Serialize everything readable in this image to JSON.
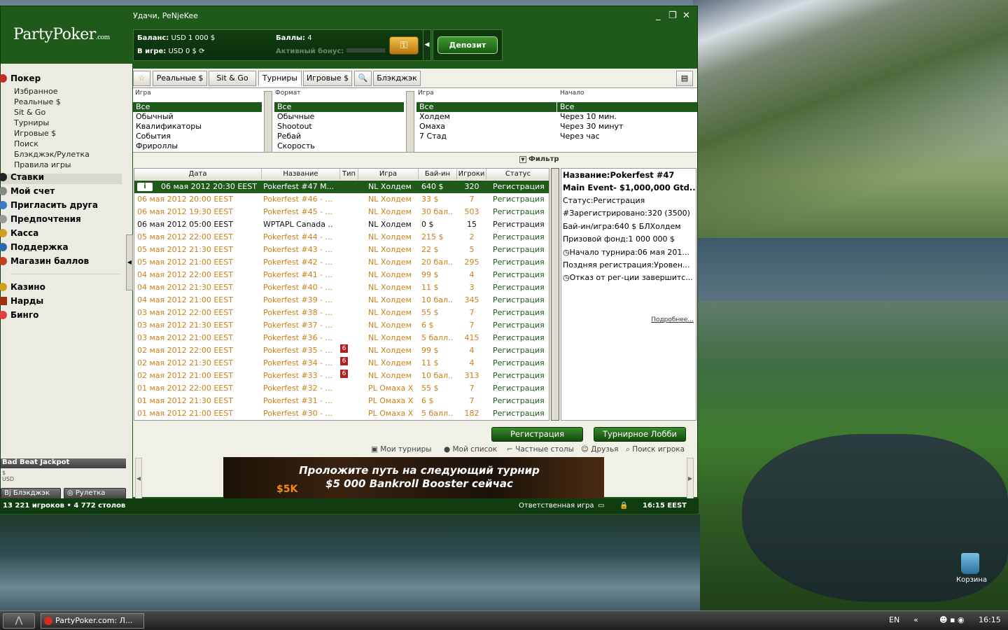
{
  "window": {
    "greeting": "Удачи, PeNjeKee",
    "logo": "PartyPoker",
    "logo_suffix": ".com",
    "controls": [
      "_",
      "❐",
      "✕"
    ]
  },
  "account": {
    "balance_label": "Баланс:",
    "balance_value": "USD 1 000 $",
    "ingame_label": "В игре:",
    "ingame_value": "USD 0 $",
    "points_label": "Баллы:",
    "points_value": "4",
    "bonus_label": "Активный бонус:",
    "deposit": "Депозит"
  },
  "sidebar": {
    "poker": "Покер",
    "poker_items": [
      "Избранное",
      "Реальные $",
      "Sit & Go",
      "Турниры",
      "Игровые $",
      "Поиск",
      "Блэкджэк/Рулетка",
      "Правила игры"
    ],
    "sections": [
      "Ставки",
      "Мой счет",
      "Пригласить друга",
      "Предпочтения",
      "Касса",
      "Поддержка",
      "Магазин баллов"
    ],
    "games": [
      "Казино",
      "Нарды",
      "Бинго"
    ],
    "jackpot": "Bad Beat Jackpot",
    "jackpot_cur": "$",
    "jackpot_usd": "USD",
    "blackjack": "Блэкджэк",
    "roulette": "Рулетка"
  },
  "tabs": [
    "Реальные $",
    "Sit & Go",
    "Турниры",
    "Игровые $",
    "Блэкджэк"
  ],
  "filters": {
    "game1_header": "Игра",
    "game1": [
      "Все",
      "Обычный",
      "Квалификаторы",
      "События",
      "Фрироллы"
    ],
    "format_header": "Формат",
    "format": [
      "Все",
      "Обычные",
      "Shootout",
      "Ребай",
      "Скорость"
    ],
    "game2_header": "Игра",
    "game2": [
      "Все",
      "Холдем",
      "Омаха",
      "7 Стад"
    ],
    "start_header": "Начало",
    "start": [
      "Все",
      "Через 10 мин.",
      "Через 30 минут",
      "Через час"
    ],
    "filter_label": "Фильтр"
  },
  "grid": {
    "headers": [
      "Дата",
      "Название",
      "Тип",
      "Игра",
      "Бай-ин",
      "Игроки",
      "Статус"
    ],
    "rows": [
      {
        "date": "06 мая 2012 20:30 EEST",
        "name": "Pokerfest #47 M...",
        "type": "",
        "game": "NL Холдем",
        "buyin": "640 $",
        "players": "320",
        "status": "Регистрация"
      },
      {
        "date": "06 мая 2012 20:00 EEST",
        "name": "Pokerfest #46 - ...",
        "type": "",
        "game": "NL Холдем",
        "buyin": "33 $",
        "players": "7",
        "status": "Регистрация"
      },
      {
        "date": "06 мая 2012 19:30 EEST",
        "name": "Pokerfest #45 - ...",
        "type": "",
        "game": "NL Холдем",
        "buyin": "30 бал..",
        "players": "503",
        "status": "Регистрация"
      },
      {
        "date": "06 мая 2012 05:00 EEST",
        "name": "WPTAPL Canada ..",
        "type": "",
        "game": "NL Холдем",
        "buyin": "0 $",
        "players": "15",
        "status": "Регистрация"
      },
      {
        "date": "05 мая 2012 22:00 EEST",
        "name": "Pokerfest #44 - ...",
        "type": "",
        "game": "NL Холдем",
        "buyin": "215 $",
        "players": "2",
        "status": "Регистрация"
      },
      {
        "date": "05 мая 2012 21:30 EEST",
        "name": "Pokerfest #43 - ...",
        "type": "",
        "game": "NL Холдем",
        "buyin": "22 $",
        "players": "5",
        "status": "Регистрация"
      },
      {
        "date": "05 мая 2012 21:00 EEST",
        "name": "Pokerfest #42 - ...",
        "type": "",
        "game": "NL Холдем",
        "buyin": "20 бал..",
        "players": "295",
        "status": "Регистрация"
      },
      {
        "date": "04 мая 2012 22:00 EEST",
        "name": "Pokerfest #41 - ...",
        "type": "",
        "game": "NL Холдем",
        "buyin": "99 $",
        "players": "4",
        "status": "Регистрация"
      },
      {
        "date": "04 мая 2012 21:30 EEST",
        "name": "Pokerfest #40 - ...",
        "type": "",
        "game": "NL Холдем",
        "buyin": "11 $",
        "players": "3",
        "status": "Регистрация"
      },
      {
        "date": "04 мая 2012 21:00 EEST",
        "name": "Pokerfest #39 - ...",
        "type": "",
        "game": "NL Холдем",
        "buyin": "10 бал..",
        "players": "345",
        "status": "Регистрация"
      },
      {
        "date": "03 мая 2012 22:00 EEST",
        "name": "Pokerfest #38 - ...",
        "type": "",
        "game": "NL Холдем",
        "buyin": "55 $",
        "players": "7",
        "status": "Регистрация"
      },
      {
        "date": "03 мая 2012 21:30 EEST",
        "name": "Pokerfest #37 - ...",
        "type": "",
        "game": "NL Холдем",
        "buyin": "6 $",
        "players": "7",
        "status": "Регистрация"
      },
      {
        "date": "03 мая 2012 21:00 EEST",
        "name": "Pokerfest #36 - ...",
        "type": "",
        "game": "NL Холдем",
        "buyin": "5 балл..",
        "players": "415",
        "status": "Регистрация"
      },
      {
        "date": "02 мая 2012 22:00 EEST",
        "name": "Pokerfest #35 - ...",
        "type": "6",
        "game": "NL Холдем",
        "buyin": "99 $",
        "players": "4",
        "status": "Регистрация"
      },
      {
        "date": "02 мая 2012 21:30 EEST",
        "name": "Pokerfest #34 - ...",
        "type": "6",
        "game": "NL Холдем",
        "buyin": "11 $",
        "players": "4",
        "status": "Регистрация"
      },
      {
        "date": "02 мая 2012 21:00 EEST",
        "name": "Pokerfest #33 - ...",
        "type": "6",
        "game": "NL Холдем",
        "buyin": "10 бал..",
        "players": "313",
        "status": "Регистрация"
      },
      {
        "date": "01 мая 2012 22:00 EEST",
        "name": "Pokerfest #32 - ...",
        "type": "",
        "game": "PL Омаха X",
        "buyin": "55 $",
        "players": "7",
        "status": "Регистрация"
      },
      {
        "date": "01 мая 2012 21:30 EEST",
        "name": "Pokerfest #31 - ...",
        "type": "",
        "game": "PL Омаха X",
        "buyin": "6 $",
        "players": "7",
        "status": "Регистрация"
      },
      {
        "date": "01 мая 2012 21:00 EEST",
        "name": "Pokerfest #30 - ...",
        "type": "",
        "game": "PL Омаха X",
        "buyin": "5 балл..",
        "players": "182",
        "status": "Регистрация"
      }
    ]
  },
  "info": {
    "name": "Название:Pokerfest #47",
    "event": "Main Event- $1,000,000 Gtd...",
    "status": "Статус:Регистрация",
    "registered": "#Зарегистрировано:320 (3500)",
    "buyin": "Бай-ин/игра:640 $ БЛХолдем",
    "prize": "Призовой фонд:1 000 000 $",
    "start": "Начало турнира:06 мая 201...",
    "late": "Поздняя регистрация:Уровен...",
    "unreg": "Отказ от рег-ции завершитс...",
    "more": "Подробнее..."
  },
  "actions": {
    "register": "Регистрация",
    "lobby": "Турнирное Лобби"
  },
  "links": [
    "Мои турниры",
    "Мой список",
    "Частные столы",
    "Друзья",
    "Поиск игрока"
  ],
  "banner": {
    "line1": "Проложите путь на следующий турнир",
    "line2": "$5 000 Bankroll Booster сейчас",
    "amount": "$5K"
  },
  "statusbar": {
    "counts": "13 221 игроков  •  4 772 столов",
    "responsible": "Ответственная игра",
    "time": "16:15 EEST"
  },
  "taskbar": {
    "app": "PartyPoker.com: Л...",
    "lang": "EN",
    "clock": "16:15",
    "recycle": "Корзина"
  }
}
